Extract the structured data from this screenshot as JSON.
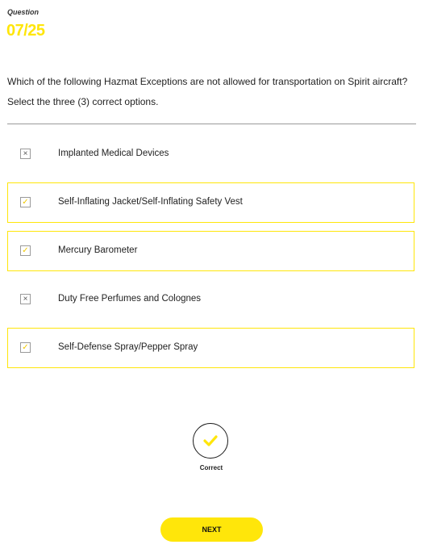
{
  "question": {
    "label": "Question",
    "number": "07/25",
    "text": "Which of the following Hazmat Exceptions are not allowed for transportation on Spirit aircraft?",
    "instruction": "Select the three (3) correct options."
  },
  "options": [
    {
      "label": "Implanted Medical Devices",
      "selected": false,
      "mark": "×"
    },
    {
      "label": "Self-Inflating Jacket/Self-Inflating Safety Vest",
      "selected": true,
      "mark": "✓"
    },
    {
      "label": "Mercury Barometer",
      "selected": true,
      "mark": "✓"
    },
    {
      "label": "Duty Free Perfumes and Colognes",
      "selected": false,
      "mark": "×"
    },
    {
      "label": "Self-Defense Spray/Pepper Spray",
      "selected": true,
      "mark": "✓"
    }
  ],
  "result": {
    "label": "Correct",
    "icon": "checkmark-icon"
  },
  "next_button": {
    "label": "NEXT"
  },
  "colors": {
    "accent": "#ffe60a",
    "check": "#f0c800",
    "text": "#222222",
    "divider": "#9a9a9a"
  }
}
